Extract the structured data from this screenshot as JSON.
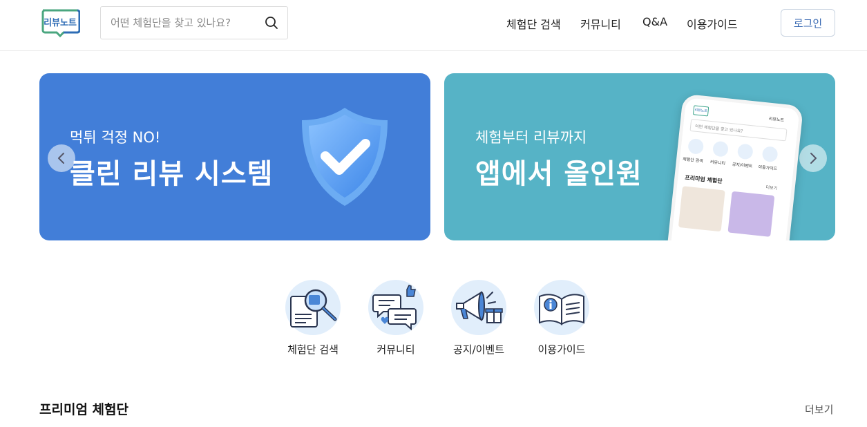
{
  "header": {
    "logo_text": "리뷰노트",
    "search_placeholder": "어떤 체험단을 찾고 있나요?",
    "nav": [
      {
        "label": "체험단 검색"
      },
      {
        "label": "커뮤니티"
      },
      {
        "label": "Q&A"
      },
      {
        "label": "이용가이드"
      }
    ],
    "login_label": "로그인"
  },
  "banners": [
    {
      "subtitle": "먹튀 걱정 NO!",
      "title": "클린 리뷰 시스템",
      "bg": "#427ed8"
    },
    {
      "subtitle": "체험부터 리뷰까지",
      "title": "앱에서 올인원",
      "bg": "#56b3c6",
      "phone": {
        "brand": "리뷰노트",
        "logo": "리뷰노트",
        "search_placeholder": "어떤 체험단을 찾고 있나요?",
        "menu": [
          "체험단 검색",
          "커뮤니티",
          "공지/이벤트",
          "이용가이드"
        ],
        "section_title": "프리미엄 체험단",
        "more": "더보기"
      }
    }
  ],
  "categories": [
    {
      "label": "체험단 검색",
      "icon": "search-document-icon"
    },
    {
      "label": "커뮤니티",
      "icon": "chat-bubbles-icon"
    },
    {
      "label": "공지/이벤트",
      "icon": "megaphone-gift-icon"
    },
    {
      "label": "이용가이드",
      "icon": "info-book-icon"
    }
  ],
  "premium": {
    "title": "프리미엄 체험단",
    "more": "더보기"
  },
  "colors": {
    "accent": "#3a6ab3",
    "banner_blue": "#427ed8",
    "banner_teal": "#56b3c6",
    "icon_bg": "#e1eefb"
  }
}
